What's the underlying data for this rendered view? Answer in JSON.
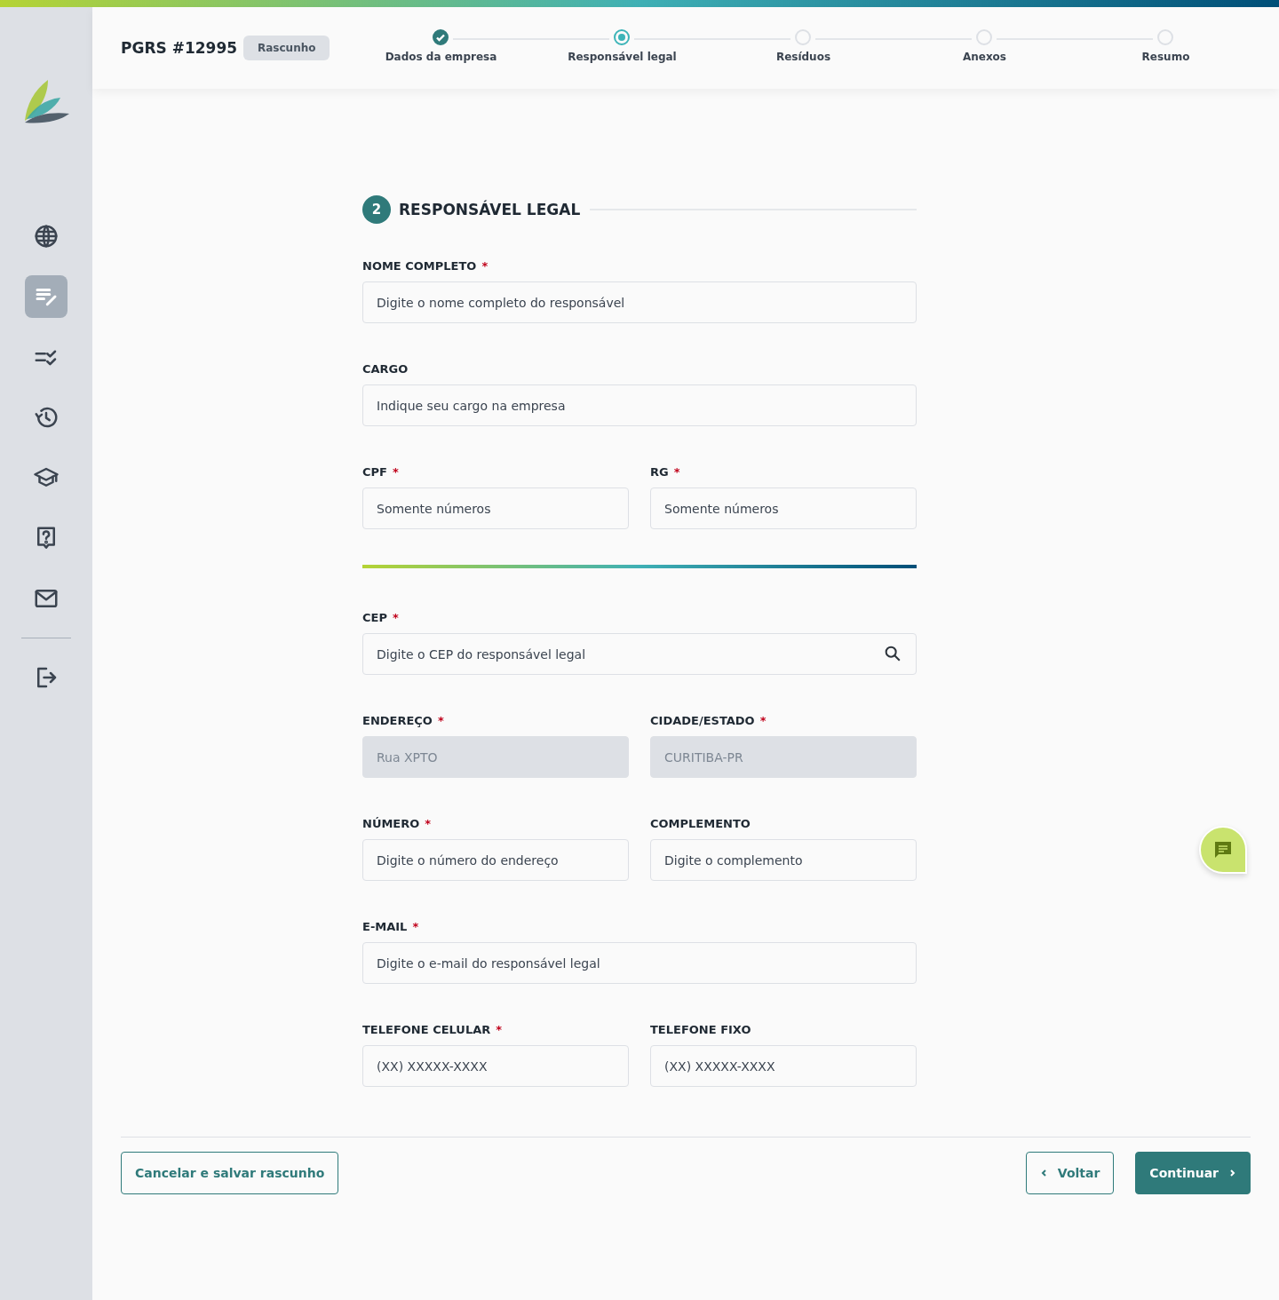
{
  "header": {
    "title": "PGRS #12995",
    "badge": "Rascunho"
  },
  "steps": [
    {
      "label": "Dados da empresa",
      "completed": true,
      "selected": false
    },
    {
      "label": "Responsável legal",
      "completed": false,
      "selected": true
    },
    {
      "label": "Resíduos",
      "completed": false,
      "selected": false
    },
    {
      "label": "Anexos",
      "completed": false,
      "selected": false
    },
    {
      "label": "Resumo",
      "completed": false,
      "selected": false
    }
  ],
  "sidebar": {
    "items": [
      {
        "selected": false
      },
      {
        "selected": true
      },
      {
        "selected": false
      },
      {
        "selected": false
      },
      {
        "selected": false
      },
      {
        "selected": false
      },
      {
        "selected": false
      },
      {
        "selected": false
      }
    ]
  },
  "section": {
    "number": "2",
    "title": "RESPONSÁVEL LEGAL"
  },
  "rows": [
    {
      "fields": [
        {
          "label": "NOME COMPLETO",
          "required_mark": "*",
          "placeholder": "Digite o nome completo do responsável",
          "disabled": false
        }
      ]
    },
    {
      "fields": [
        {
          "label": "CARGO",
          "placeholder": "Indique seu cargo na empresa",
          "disabled": false
        }
      ]
    },
    {
      "fields": [
        {
          "label": "CPF",
          "required_mark": "*",
          "placeholder": "Somente números",
          "disabled": false
        },
        {
          "label": "RG",
          "required_mark": "*",
          "placeholder": "Somente números",
          "disabled": false
        }
      ]
    },
    {
      "kind": "divider"
    },
    {
      "fields": [
        {
          "label": "CEP",
          "required_mark": "*",
          "placeholder": "Digite o CEP do responsável legal",
          "disabled": false,
          "kind": "search"
        }
      ]
    },
    {
      "fields": [
        {
          "label": "ENDEREÇO",
          "required_mark": "*",
          "value": "Rua XPTO",
          "disabled": true
        },
        {
          "label": "CIDADE/ESTADO",
          "required_mark": "*",
          "value": "CURITIBA-PR",
          "disabled": true
        }
      ]
    },
    {
      "fields": [
        {
          "label": "NÚMERO",
          "required_mark": "*",
          "placeholder": "Digite o número do endereço",
          "disabled": false
        },
        {
          "label": "COMPLEMENTO",
          "placeholder": "Digite o complemento",
          "disabled": false
        }
      ]
    },
    {
      "fields": [
        {
          "label": "E-MAIL",
          "required_mark": "*",
          "placeholder": "Digite o e-mail do responsável legal",
          "disabled": false
        }
      ]
    },
    {
      "fields": [
        {
          "label": "TELEFONE CELULAR",
          "required_mark": "*",
          "placeholder": "(XX) XXXXX-XXXX",
          "disabled": false
        },
        {
          "label": "TELEFONE FIXO",
          "placeholder": "(XX) XXXXX-XXXX",
          "disabled": false
        }
      ]
    }
  ],
  "footer": {
    "cancel": "Cancelar e salvar rascunho",
    "back": "Voltar",
    "next": "Continuar"
  }
}
